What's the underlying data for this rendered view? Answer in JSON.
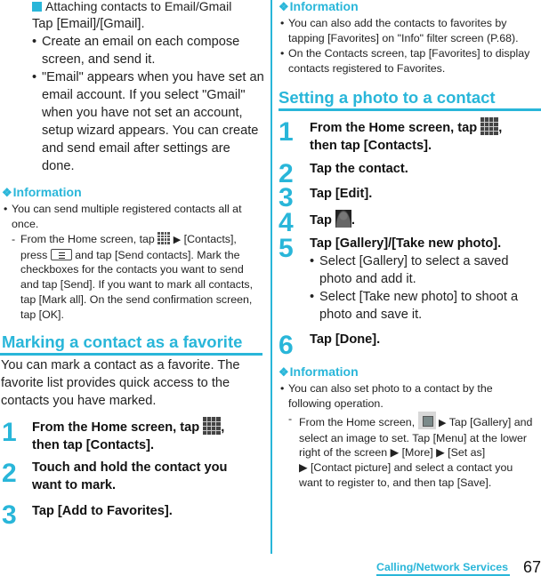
{
  "left": {
    "subsection_title": "Attaching contacts to Email/Gmail",
    "intro": "Tap [Email]/[Gmail].",
    "bullets": [
      [
        "Create an email on each compose",
        "screen, and send it."
      ],
      [
        "\"Email\" appears when you have set an",
        "email account. If you select \"Gmail\"",
        "when you have not set an account,",
        "setup wizard appears. You can create",
        "and send email after settings are",
        "done."
      ]
    ],
    "info": {
      "title": "Information",
      "bullet_lines": [
        "You can send multiple registered contacts all at",
        "once."
      ],
      "sub_lines": {
        "line1_pre": "From the Home screen, tap ",
        "line1_post": " [Contacts],",
        "line2_pre": "press ",
        "line2_post": " and tap [Send contacts]. Mark the",
        "rest": [
          "checkboxes for the contacts you want to send",
          "and tap [Send]. If you want to mark all contacts,",
          "tap [Mark all]. On the send confirmation screen,",
          "tap [OK]."
        ]
      }
    },
    "section": {
      "title": "Marking a contact as a favorite",
      "intro": [
        "You can mark a contact as a favorite. The",
        "favorite list provides quick access to the",
        "contacts you have marked."
      ],
      "steps": [
        {
          "num": "1",
          "line1": "From the Home screen, tap ",
          "line1_end": ",",
          "line2": "then tap [Contacts]."
        },
        {
          "num": "2",
          "line1": "Touch and hold the contact you",
          "line2": "want to mark."
        },
        {
          "num": "3",
          "line1": "Tap [Add to Favorites]."
        }
      ]
    }
  },
  "right": {
    "info1": {
      "title": "Information",
      "bullets": [
        [
          "You can also add the contacts to favorites by",
          "tapping [Favorites] on \"Info\" filter screen (P.68)."
        ],
        [
          "On the Contacts screen, tap [Favorites] to display",
          "contacts registered to Favorites."
        ]
      ]
    },
    "section": {
      "title": "Setting a photo to a contact",
      "steps": [
        {
          "num": "1",
          "line1": "From the Home screen, tap ",
          "line1_end": ",",
          "line2": "then tap [Contacts]."
        },
        {
          "num": "2",
          "line1": "Tap the contact."
        },
        {
          "num": "3",
          "line1": "Tap [Edit]."
        },
        {
          "num": "4",
          "line1": "Tap ",
          "line1_end": "."
        },
        {
          "num": "5",
          "line1": "Tap [Gallery]/[Take new photo].",
          "bullets": [
            [
              "Select [Gallery] to select a saved",
              "photo and add it."
            ],
            [
              "Select [Take new photo] to shoot a",
              "photo and save it."
            ]
          ]
        },
        {
          "num": "6",
          "line1": "Tap [Done]."
        }
      ]
    },
    "info2": {
      "title": "Information",
      "bullet_lines": [
        "You can also set photo to a contact by the",
        "following operation."
      ],
      "sub": {
        "line1_pre": "From the Home screen, ",
        "line1_post": " Tap [Gallery] and",
        "line2": "select an image to set. Tap [Menu] at the lower",
        "line3": "right of the screen ▶ [More] ▶ [Set as]",
        "line4": "▶ [Contact picture] and select a contact you",
        "line5": "want to register to, and then tap [Save]."
      }
    }
  },
  "footer": {
    "section_label": "Calling/Network Services",
    "page_number": "67"
  },
  "icons": {
    "diamond": "❖",
    "bullet": "•",
    "dash": "-",
    "arrow": "▶"
  },
  "colors": {
    "accent": "#29b6d9",
    "text": "#222222"
  }
}
